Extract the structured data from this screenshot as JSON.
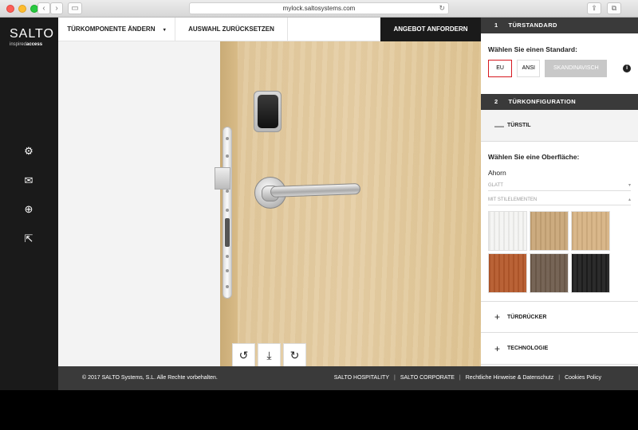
{
  "browser": {
    "url": "mylock.saltosystems.com",
    "back_label": "‹",
    "forward_label": "›",
    "sidebar_toggle_label": "▭",
    "reload_label": "↻",
    "share_label": "⇪",
    "tabs_label": "⧉",
    "new_tab_label": "+"
  },
  "sidebar": {
    "logo_main": "SALTO",
    "logo_sub_light": "inspired",
    "logo_sub_bold": "access",
    "icons": [
      {
        "name": "gear-icon",
        "glyph": "⚙"
      },
      {
        "name": "mail-icon",
        "glyph": "✉"
      },
      {
        "name": "globe-icon",
        "glyph": "⊕"
      },
      {
        "name": "external-link-icon",
        "glyph": "⇱"
      }
    ]
  },
  "toolbar": {
    "change_component": "TÜRKOMPONENTE ÄNDERN",
    "change_component_caret": "▾",
    "reset_selection": "AUSWAHL ZURÜCKSETZEN",
    "request_quote": "ANGEBOT ANFORDERN"
  },
  "viewer": {
    "rotate_left": "↺",
    "download": "⤓",
    "rotate_right": "↻"
  },
  "footer": {
    "copyright": "© 2017 SALTO Systems, S.L. Alle Rechte vorbehalten.",
    "links": [
      "SALTO HOSPITALITY",
      "SALTO CORPORATE",
      "Rechtliche Hinweise & Datenschutz",
      "Cookies Policy"
    ],
    "separator": "|"
  },
  "panel": {
    "section1": {
      "num": "1",
      "title": "TÜRSTANDARD"
    },
    "choose_standard": "Wählen Sie einen Standard:",
    "standards": {
      "eu": "EU",
      "ansi": "ANSI",
      "skandinavisch": "SKANDINAVISCH"
    },
    "selected_standard": "EU",
    "info_glyph": "i",
    "section2": {
      "num": "2",
      "title": "TÜRKONFIGURATION"
    },
    "tuerstil": {
      "symbol": "—",
      "label": "TÜRSTIL"
    },
    "choose_surface": "Wählen Sie eine Oberfläche:",
    "surface_value": "Ahorn",
    "filters": [
      {
        "label": "GLATT",
        "caret": "▾"
      },
      {
        "label": "MIT STILELEMENTEN",
        "caret": "▴"
      }
    ],
    "swatch_colors": [
      "#f4f4f2",
      "#c9a677",
      "#d7b383",
      "#b5582a",
      "#6e5b4b",
      "#1e1e1e"
    ],
    "tuerdruecker": {
      "symbol": "+",
      "label": "TÜRDRÜCKER"
    },
    "technologie": {
      "symbol": "+",
      "label": "TECHNOLOGIE"
    }
  }
}
